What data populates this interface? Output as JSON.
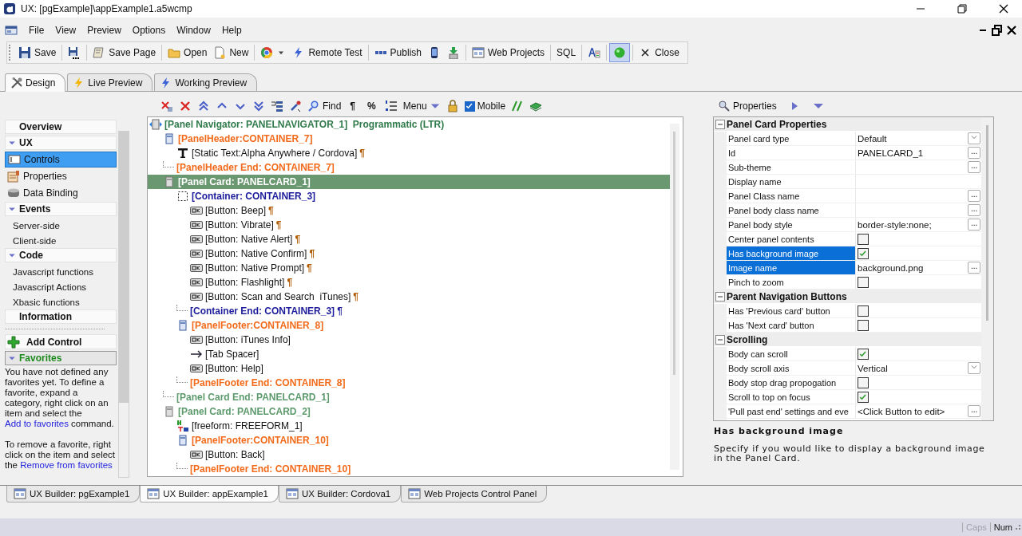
{
  "window": {
    "title": "UX: [pgExample]\\appExample1.a5wcmp"
  },
  "menu": [
    "File",
    "View",
    "Preview",
    "Options",
    "Window",
    "Help"
  ],
  "toolbar": [
    {
      "kind": "button",
      "label": "Save"
    },
    {
      "kind": "separator"
    },
    {
      "kind": "icon"
    },
    {
      "kind": "separator"
    },
    {
      "kind": "button",
      "label": "Save Page"
    },
    {
      "kind": "separator"
    },
    {
      "kind": "button",
      "label": "Open"
    },
    {
      "kind": "button",
      "label": "New"
    },
    {
      "kind": "separator"
    },
    {
      "kind": "dropdown"
    },
    {
      "kind": "button",
      "label": "Remote Test"
    },
    {
      "kind": "separator"
    },
    {
      "kind": "button",
      "label": "Publish"
    },
    {
      "kind": "icon"
    },
    {
      "kind": "icon"
    },
    {
      "kind": "separator"
    },
    {
      "kind": "button",
      "label": "Web Projects"
    },
    {
      "kind": "separator"
    },
    {
      "kind": "button",
      "label": "SQL"
    },
    {
      "kind": "separator"
    },
    {
      "kind": "icon"
    },
    {
      "kind": "separator"
    },
    {
      "kind": "toggle",
      "selected": true
    },
    {
      "kind": "separator"
    },
    {
      "kind": "button",
      "label": "Close"
    }
  ],
  "view_tabs": [
    {
      "label": "Design",
      "selected": true
    },
    {
      "label": "Live Preview",
      "selected": false
    },
    {
      "label": "Working Preview",
      "selected": false
    }
  ],
  "sidebar": {
    "items": [
      {
        "kind": "heading",
        "label": "Overview"
      },
      {
        "kind": "heading",
        "label": "UX",
        "expanded": true
      },
      {
        "kind": "item",
        "label": "Controls",
        "selected": true
      },
      {
        "kind": "item",
        "label": "Properties",
        "selected": false
      },
      {
        "kind": "item",
        "label": "Data Binding",
        "selected": false
      },
      {
        "kind": "heading",
        "label": "Events",
        "expanded": true
      },
      {
        "kind": "sub",
        "label": "Server-side",
        "selected": false
      },
      {
        "kind": "sub",
        "label": "Client-side",
        "selected": false
      },
      {
        "kind": "heading",
        "label": "Code",
        "expanded": true
      },
      {
        "kind": "sub",
        "label": "Javascript functions",
        "selected": false
      },
      {
        "kind": "sub",
        "label": "Javascript Actions",
        "selected": false
      },
      {
        "kind": "sub",
        "label": "Xbasic functions",
        "selected": false
      },
      {
        "kind": "heading",
        "label": "Information"
      }
    ],
    "add_control": "Add Control",
    "favorites": {
      "label": "Favorites",
      "expanded": true
    },
    "help": [
      [
        {
          "text": "You have not defined any favorites yet. To define a favorite, expand a category, right click on an item and select the "
        },
        {
          "link": "Add to favorites"
        },
        {
          "text": " command."
        }
      ],
      [
        {
          "text": "To remove a favorite, right click on the item and select the "
        },
        {
          "link": "Remove from favorites"
        }
      ]
    ]
  },
  "tree_toolbar": [
    {
      "kind": "icon"
    },
    {
      "kind": "icon"
    },
    {
      "kind": "icon"
    },
    {
      "kind": "icon"
    },
    {
      "kind": "icon"
    },
    {
      "kind": "icon"
    },
    {
      "kind": "icon"
    },
    {
      "kind": "icon"
    },
    {
      "kind": "button",
      "label": "Find"
    },
    {
      "kind": "text",
      "label": "¶"
    },
    {
      "kind": "text",
      "label": "%"
    },
    {
      "kind": "icon"
    },
    {
      "kind": "menu",
      "label": "Menu"
    },
    {
      "kind": "icon"
    },
    {
      "kind": "checkbox",
      "label": "Mobile",
      "checked": true
    },
    {
      "kind": "icon"
    },
    {
      "kind": "icon"
    }
  ],
  "tree": {
    "nodes": [
      {
        "kind": "navigator",
        "text": "[Panel Navigator: PANELNAVIGATOR_1]  Programmatic (LTR)",
        "selected": false,
        "children": [
          {
            "kind": "header",
            "text": "[PanelHeader:CONTAINER_7]",
            "selected": false,
            "children": [
              {
                "kind": "static-text",
                "text": "[Static Text:Alpha Anywhere / Cordova]",
                "mark": "¶",
                "selected": false
              }
            ]
          },
          {
            "kind": "header-end",
            "text": "[PanelHeader End: CONTAINER_7]",
            "selected": false
          },
          {
            "kind": "card",
            "text": "[Panel Card: PANELCARD_1]",
            "selected": true,
            "children": [
              {
                "kind": "container",
                "text": "[Container: CONTAINER_3]",
                "selected": false,
                "children": [
                  {
                    "kind": "button",
                    "text": "[Button: Beep]",
                    "mark": "¶",
                    "selected": false
                  },
                  {
                    "kind": "button",
                    "text": "[Button: Vibrate]",
                    "mark": "¶",
                    "selected": false
                  },
                  {
                    "kind": "button",
                    "text": "[Button: Native Alert]",
                    "mark": "¶",
                    "selected": false
                  },
                  {
                    "kind": "button",
                    "text": "[Button: Native Confirm]",
                    "mark": "¶",
                    "selected": false
                  },
                  {
                    "kind": "button",
                    "text": "[Button: Native Prompt]",
                    "mark": "¶",
                    "selected": false
                  },
                  {
                    "kind": "button",
                    "text": "[Button: Flashlight]",
                    "mark": "¶",
                    "selected": false
                  },
                  {
                    "kind": "button",
                    "text": "[Button: Scan and Search  iTunes]",
                    "mark": "¶",
                    "selected": false
                  }
                ]
              },
              {
                "kind": "container-end",
                "text": "[Container End: CONTAINER_3]",
                "mark": "¶",
                "selected": false
              },
              {
                "kind": "header",
                "text": "[PanelFooter:CONTAINER_8]",
                "selected": false,
                "children": [
                  {
                    "kind": "button",
                    "text": "[Button: iTunes Info]",
                    "selected": false
                  },
                  {
                    "kind": "spacer",
                    "text": "[Tab Spacer]",
                    "selected": false
                  },
                  {
                    "kind": "button",
                    "text": "[Button: Help]",
                    "selected": false
                  }
                ]
              },
              {
                "kind": "header-end",
                "text": "[PanelFooter End: CONTAINER_8]",
                "selected": false
              }
            ]
          },
          {
            "kind": "card-end",
            "text": "[Panel Card End: PANELCARD_1]",
            "selected": false
          },
          {
            "kind": "card",
            "text": "[Panel Card: PANELCARD_2]",
            "selected": false,
            "children": [
              {
                "kind": "freeform",
                "text": "[freeform: FREEFORM_1]",
                "selected": false
              },
              {
                "kind": "header",
                "text": "[PanelFooter:CONTAINER_10]",
                "selected": false,
                "children": [
                  {
                    "kind": "button",
                    "text": "[Button: Back]",
                    "selected": false
                  }
                ]
              },
              {
                "kind": "header-end",
                "text": "[PanelFooter End: CONTAINER_10]",
                "selected": false
              }
            ]
          }
        ]
      }
    ]
  },
  "properties": {
    "label": "Properties",
    "groups": [
      {
        "title": "Panel Card Properties",
        "expanded": true,
        "rows": [
          {
            "kind": "dropdown",
            "name": "Panel card type",
            "value": "Default",
            "selected": false
          },
          {
            "kind": "text",
            "name": "Id",
            "value": "PANELCARD_1",
            "button": "...",
            "selected": false
          },
          {
            "kind": "text",
            "name": "Sub-theme",
            "button": "...",
            "selected": false
          },
          {
            "kind": "text",
            "name": "Display name",
            "selected": false
          },
          {
            "kind": "text",
            "name": "Panel Class name",
            "button": "...",
            "selected": false
          },
          {
            "kind": "text",
            "name": "Panel body class name",
            "button": "...",
            "selected": false
          },
          {
            "kind": "text",
            "name": "Panel body style",
            "value": "border-style:none;",
            "button": "...",
            "selected": false
          },
          {
            "kind": "check",
            "name": "Center panel contents",
            "checked": false,
            "selected": false
          },
          {
            "kind": "check",
            "name": "Has background image",
            "checked": true,
            "selected": true
          },
          {
            "kind": "text",
            "name": "Image name",
            "value": "background.png",
            "button": "...",
            "selected": true
          },
          {
            "kind": "check",
            "name": "Pinch to zoom",
            "checked": false,
            "selected": false
          }
        ]
      },
      {
        "title": "Parent Navigation Buttons",
        "expanded": true,
        "rows": [
          {
            "kind": "check",
            "name": "Has 'Previous card' button",
            "checked": false,
            "selected": false
          },
          {
            "kind": "check",
            "name": "Has 'Next card' button",
            "checked": false,
            "selected": false
          }
        ]
      },
      {
        "title": "Scrolling",
        "expanded": true,
        "rows": [
          {
            "kind": "check",
            "name": "Body can scroll",
            "checked": true,
            "selected": false
          },
          {
            "kind": "dropdown",
            "name": "Body scroll axis",
            "value": "Vertical",
            "selected": false
          },
          {
            "kind": "check",
            "name": "Body stop drag propogation",
            "checked": false,
            "selected": false
          },
          {
            "kind": "check",
            "name": "Scroll to top on focus",
            "checked": true,
            "selected": false
          },
          {
            "kind": "text",
            "name": "'Pull past end' settings and eve",
            "value": "<Click Button to edit>",
            "button": "...",
            "selected": false
          }
        ]
      }
    ]
  },
  "description": {
    "title": "Has background image",
    "text": "Specify if you would like to display a background image in the Panel Card."
  },
  "document_tabs": [
    {
      "label": "UX Builder: pgExample1",
      "selected": false
    },
    {
      "label": "UX Builder: appExample1",
      "selected": true
    },
    {
      "label": "UX Builder: Cordova1",
      "selected": false
    },
    {
      "label": "Web Projects Control Panel",
      "selected": false
    }
  ],
  "status_bar": [
    {
      "label": "Caps",
      "disabled": true
    },
    {
      "label": "Num",
      "disabled": false
    }
  ]
}
